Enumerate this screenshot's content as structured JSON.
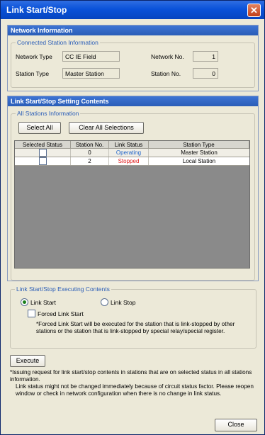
{
  "window": {
    "title": "Link Start/Stop",
    "close_glyph": "✕"
  },
  "network_info": {
    "header": "Network Information",
    "group_title": "Connected Station Information",
    "network_type_label": "Network Type",
    "network_type_value": "CC IE Field",
    "network_no_label": "Network No.",
    "network_no_value": "1",
    "station_type_label": "Station Type",
    "station_type_value": "Master Station",
    "station_no_label": "Station No.",
    "station_no_value": "0"
  },
  "setting": {
    "header": "Link Start/Stop Setting Contents",
    "group_title": "All Stations Information",
    "select_all_label": "Select All",
    "clear_all_label": "Clear All Selections",
    "columns": [
      "Selected Status",
      "Station No.",
      "Link Status",
      "Station Type"
    ],
    "rows": [
      {
        "station_no": "0",
        "link_status": "Operating",
        "station_type": "Master Station"
      },
      {
        "station_no": "2",
        "link_status": "Stopped",
        "station_type": "Local Station"
      }
    ]
  },
  "executing": {
    "group_title": "Link Start/Stop Executing Contents",
    "link_start_label": "Link Start",
    "link_stop_label": "Link Stop",
    "forced_label": "Forced Link Start",
    "forced_note": "*Forced Link Start will be executed for the station that is link-stopped by other stations or the station that is link-stopped by special relay/special register."
  },
  "execute_label": "Execute",
  "footer_note_1": "*Issuing request for link start/stop contents in stations that are on selected status in all stations information.",
  "footer_note_2": "Link status might not be changed immediately because of circuit status factor. Please reopen window or check in network configuration when there is no change in link status.",
  "close_label": "Close",
  "colors": {
    "title_bar": "#0a52d9",
    "panel_header": "#2a5db7",
    "operating": "#1e63c8",
    "stopped": "#e11b1b"
  }
}
